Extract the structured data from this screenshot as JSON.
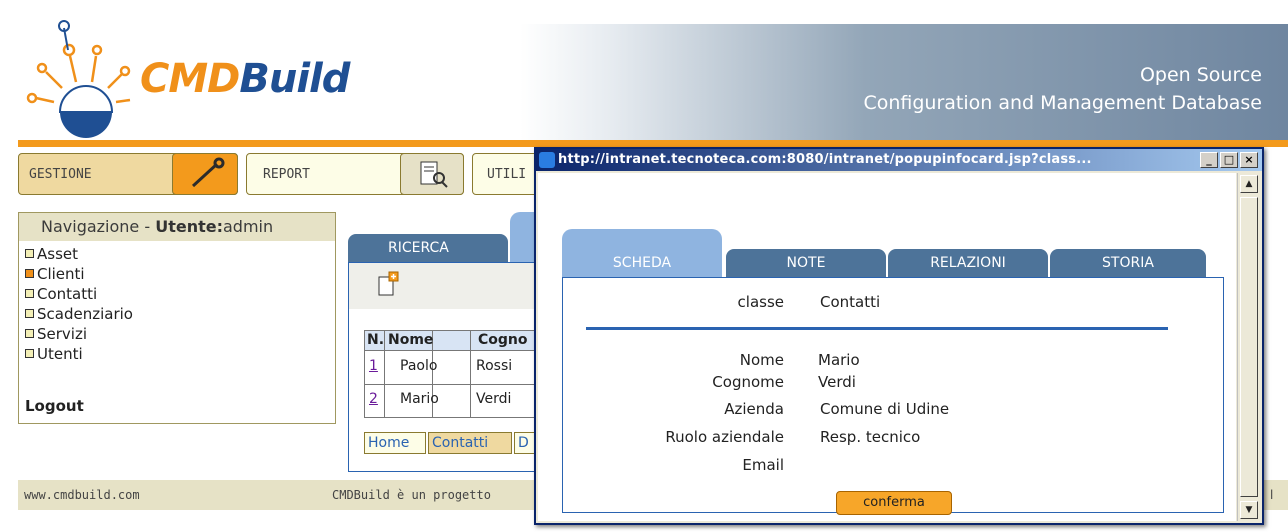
{
  "header": {
    "logo_cmd": "CMD",
    "logo_build": "Build",
    "tagline_line1": "Open Source",
    "tagline_line2": "Configuration and Management Database",
    "accent_color": "#f39a1c",
    "brand_blue": "#1f4f93"
  },
  "menu": {
    "gestione": "GESTIONE",
    "report": "REPORT",
    "utili": "UTILI"
  },
  "navigation": {
    "title_prefix": "Navigazione - ",
    "user_label": "Utente:",
    "user_name": "admin",
    "items": [
      {
        "label": "Asset",
        "active": false
      },
      {
        "label": "Clienti",
        "active": true
      },
      {
        "label": "Contatti",
        "active": false
      },
      {
        "label": "Scadenziario",
        "active": false
      },
      {
        "label": "Servizi",
        "active": false
      },
      {
        "label": "Utenti",
        "active": false
      }
    ],
    "logout": "Logout"
  },
  "main": {
    "tab_ricerca": "RICERCA",
    "table": {
      "headers": [
        "N.",
        "Nome",
        "Cogno"
      ],
      "rows": [
        {
          "n": "1",
          "nome": "Paolo",
          "cognome": "Rossi"
        },
        {
          "n": "2",
          "nome": "Mario",
          "cognome": "Verdi"
        }
      ]
    },
    "breadcrumb": [
      "Home",
      "Contatti",
      "D"
    ]
  },
  "footer": {
    "site": "www.cmdbuild.com",
    "note": "CMDBuild è un progetto",
    "trailing": "l"
  },
  "popup": {
    "title": "http://intranet.tecnoteca.com:8080/intranet/popupinfocard.jsp?class...",
    "min_btn": "_",
    "max_btn": "□",
    "close_btn": "×",
    "tabs": [
      "SCHEDA",
      "NOTE",
      "RELAZIONI",
      "STORIA"
    ],
    "class_label": "classe",
    "class_value": "Contatti",
    "fields": [
      {
        "label": "Nome",
        "value": "Mario"
      },
      {
        "label": "Cognome",
        "value": "Verdi"
      },
      {
        "label": "Azienda",
        "value": "Comune di Udine"
      },
      {
        "label": "Ruolo aziendale",
        "value": "Resp. tecnico"
      },
      {
        "label": "Email",
        "value": ""
      }
    ],
    "confirm": "conferma"
  }
}
